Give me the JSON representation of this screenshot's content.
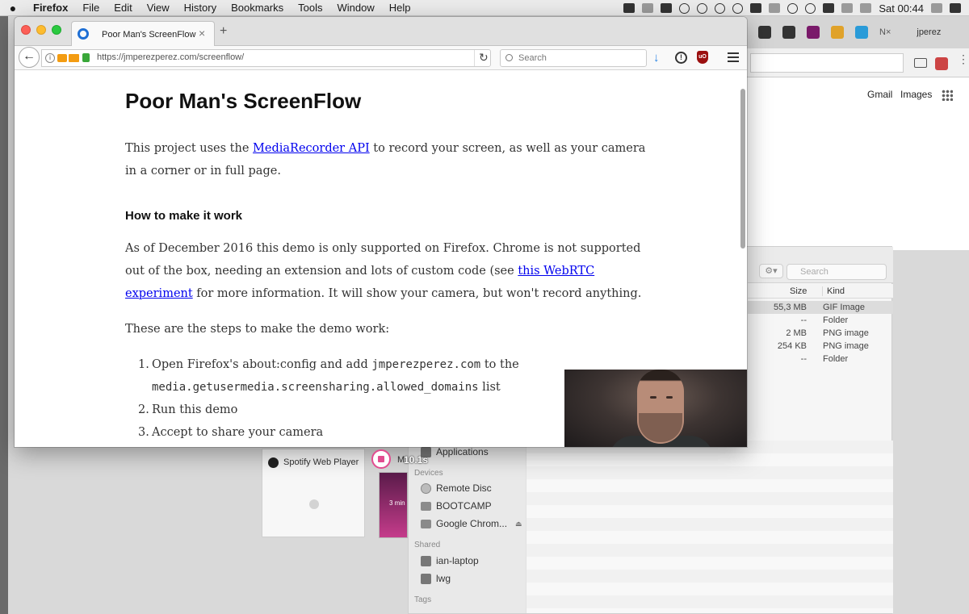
{
  "menubar": {
    "apple": "",
    "items": [
      "Firefox",
      "File",
      "Edit",
      "View",
      "History",
      "Bookmarks",
      "Tools",
      "Window",
      "Help"
    ],
    "clock": "Sat 00:44"
  },
  "chrome_bg": {
    "profile": "jperez",
    "tab_partial": "N×",
    "links": [
      "Gmail",
      "Images"
    ]
  },
  "finder": {
    "search_placeholder": "Search",
    "headers": {
      "size": "Size",
      "kind": "Kind"
    },
    "rows": [
      {
        "size": "55,3 MB",
        "kind": "GIF Image"
      },
      {
        "size": "--",
        "kind": "Folder"
      },
      {
        "size": "2 MB",
        "kind": "PNG image"
      },
      {
        "size": "254 KB",
        "kind": "PNG image"
      },
      {
        "size": "--",
        "kind": "Folder"
      }
    ],
    "sidebar": {
      "applications": "Applications",
      "devices_title": "Devices",
      "devices": [
        "Remote Disc",
        "BOOTCAMP",
        "Google Chrom..."
      ],
      "shared_title": "Shared",
      "shared": [
        "ian-laptop",
        "lwg"
      ],
      "tags_title": "Tags"
    }
  },
  "spotify": {
    "title": "Spotify Web Player",
    "partial": "M",
    "thumb_text": "3 min"
  },
  "recorder": {
    "time": "10.1s"
  },
  "firefox": {
    "tab_title": "Poor Man's ScreenFlow",
    "url": "https://jmperezperez.com/screenflow/",
    "search_placeholder": "Search"
  },
  "article": {
    "title": "Poor Man's ScreenFlow",
    "intro_before": "This project uses the ",
    "intro_link": "MediaRecorder API",
    "intro_after": " to record your screen, as well as your camera in a corner or in full page.",
    "heading": "How to make it work",
    "p2_before": "As of December 2016 this demo is only supported on Firefox. Chrome is not supported out of the box, needing an extension and lots of custom code (see ",
    "p2_link": "this WebRTC experiment",
    "p2_after": " for more information. It will show your camera, but won't record anything.",
    "p3": "These are the steps to make the demo work:",
    "steps": [
      {
        "num": "1.",
        "before": "Open Firefox's about:config and add ",
        "code": "jmperezperez.com",
        "mid": " to the",
        "code2": "media.getusermedia.screensharing.allowed_domains",
        "after": " list"
      },
      {
        "num": "2.",
        "text": "Run this demo"
      },
      {
        "num": "3.",
        "text": "Accept to share your camera"
      }
    ]
  }
}
